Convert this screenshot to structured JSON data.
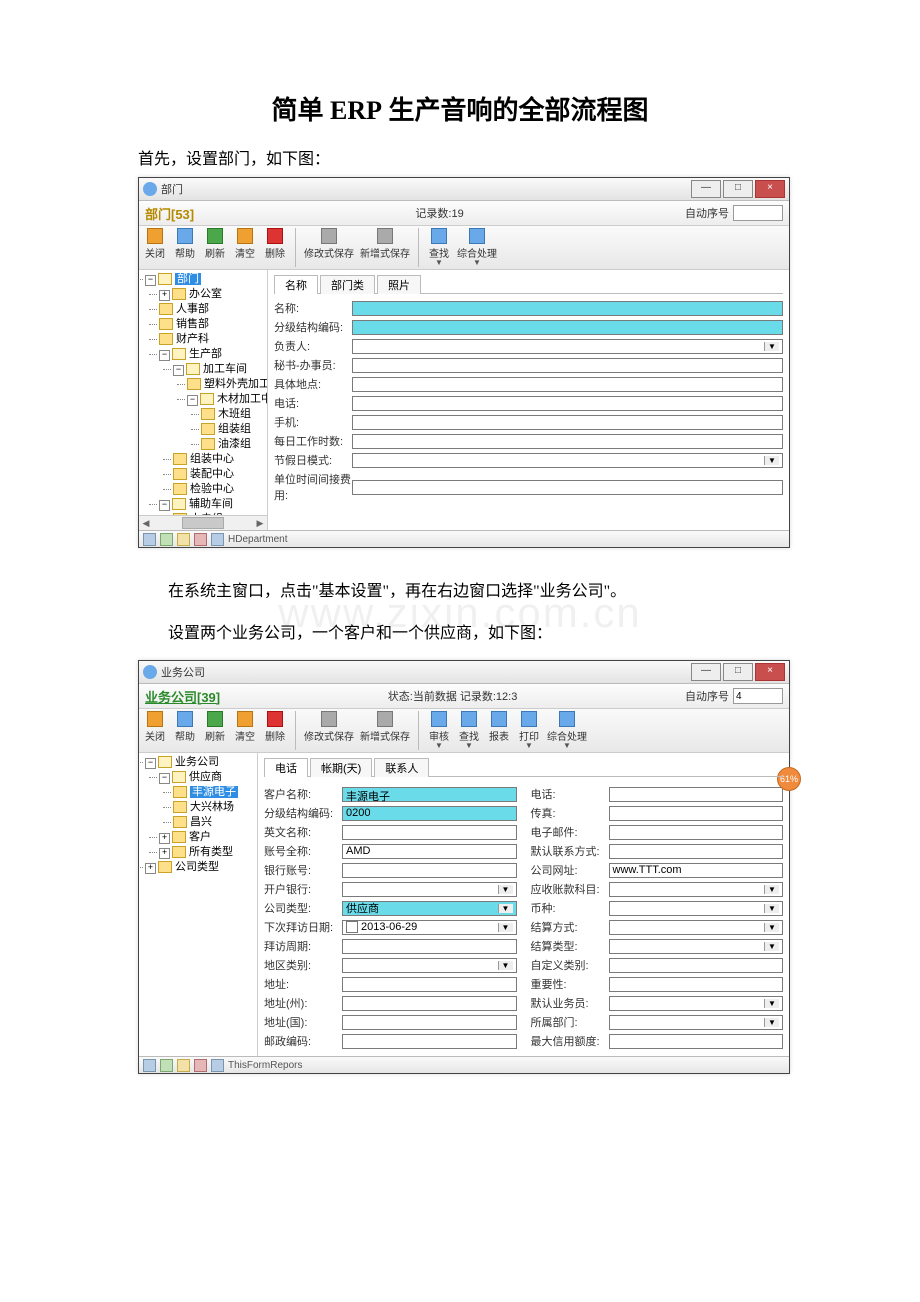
{
  "doc": {
    "title_pre": "简单 ",
    "title_erp": "ERP",
    "title_post": " 生产音响的全部流程图",
    "intro": "首先，设置部门，如下图：",
    "body1": "在系统主窗口，点击\"基本设置\"，再在右边窗口选择\"业务公司\"。",
    "body2": "设置两个业务公司，一个客户和一个供应商，如下图：",
    "watermark": "www.zixin.com.cn"
  },
  "win1": {
    "title": "部门",
    "header_title": "部门[53]",
    "record_count": "记录数:19",
    "right_label": "自动序号",
    "right_value": "",
    "toolbar": [
      "关闭",
      "帮助",
      "刷新",
      "清空",
      "删除",
      "修改式保存",
      "新增式保存",
      "查找",
      "综合处理"
    ],
    "tabs": [
      "名称",
      "部门类",
      "照片"
    ],
    "tree": {
      "root": "部门",
      "n1": "办公室",
      "n2": "人事部",
      "n3": "销售部",
      "n4": "财产科",
      "n5": "生产部",
      "n5a": "加工车间",
      "n5a1": "塑料外壳加工中",
      "n5a2": "木材加工中心",
      "n5a2a": "木班组",
      "n5a2b": "组装组",
      "n5a2c": "油漆组",
      "n5b": "组装中心",
      "n5c": "装配中心",
      "n5d": "检验中心",
      "n6": "辅助车间",
      "n6a": "水电组"
    },
    "fields": {
      "f1": "名称:",
      "f2": "分级结构编码:",
      "f3": "负责人:",
      "f4": "秘书-办事员:",
      "f5": "具体地点:",
      "f6": "电话:",
      "f7": "手机:",
      "f8": "每日工作时数:",
      "f9": "节假日模式:",
      "f10": "单位时间间接费用:"
    },
    "status": "HDepartment"
  },
  "win2": {
    "title": "业务公司",
    "header_title": "业务公司[39]",
    "center": "状态:当前数据 记录数:12:3",
    "right_label": "自动序号",
    "right_value": "4",
    "toolbar": [
      "关闭",
      "帮助",
      "刷新",
      "清空",
      "删除",
      "修改式保存",
      "新增式保存",
      "审核",
      "查找",
      "报表",
      "打印",
      "综合处理"
    ],
    "tabs": [
      "电话",
      "帐期(天)",
      "联系人"
    ],
    "tree": {
      "root": "业务公司",
      "s1": "供应商",
      "s1a": "丰源电子",
      "s1b": "大兴林场",
      "s1c": "昌兴",
      "s2": "客户",
      "s3": "所有类型",
      "s4": "公司类型"
    },
    "left_fields": {
      "f1": {
        "label": "客户名称:",
        "value": "丰源电子",
        "hl": true
      },
      "f2": {
        "label": "分级结构编码:",
        "value": "0200",
        "hl": true
      },
      "f3": {
        "label": "英文名称:",
        "value": ""
      },
      "f4": {
        "label": "账号全称:",
        "value": "AMD"
      },
      "f5": {
        "label": "银行账号:",
        "value": ""
      },
      "f6": {
        "label": "开户银行:",
        "value": "",
        "select": true
      },
      "f7": {
        "label": "公司类型:",
        "value": "供应商",
        "hl": true,
        "select": true
      },
      "f8": {
        "label": "下次拜访日期:",
        "value": "2013-06-29",
        "date": true
      },
      "f9": {
        "label": "拜访周期:",
        "value": ""
      },
      "f10": {
        "label": "地区类别:",
        "value": "",
        "select": true
      },
      "f11": {
        "label": "地址:",
        "value": ""
      },
      "f12": {
        "label": "地址(州):",
        "value": ""
      },
      "f13": {
        "label": "地址(国):",
        "value": ""
      },
      "f14": {
        "label": "邮政编码:",
        "value": ""
      }
    },
    "right_fields": {
      "r1": {
        "label": "电话:",
        "value": ""
      },
      "r2": {
        "label": "传真:",
        "value": ""
      },
      "r3": {
        "label": "电子邮件:",
        "value": ""
      },
      "r4": {
        "label": "默认联系方式:",
        "value": ""
      },
      "r5": {
        "label": "公司网址:",
        "value": "www.TTT.com"
      },
      "r6": {
        "label": "应收账款科目:",
        "value": "",
        "select": true
      },
      "r7": {
        "label": "币种:",
        "value": "",
        "select": true
      },
      "r8": {
        "label": "结算方式:",
        "value": "",
        "select": true
      },
      "r9": {
        "label": "结算类型:",
        "value": "",
        "select": true
      },
      "r10": {
        "label": "自定义类别:",
        "value": ""
      },
      "r11": {
        "label": "重要性:",
        "value": ""
      },
      "r12": {
        "label": "默认业务员:",
        "value": "",
        "select": true
      },
      "r13": {
        "label": "所属部门:",
        "value": "",
        "select": true
      },
      "r14": {
        "label": "最大信用额度:",
        "value": ""
      }
    },
    "side_badge": "61%",
    "status": "ThisFormRepors"
  },
  "winbtns": {
    "min": "—",
    "max": "□",
    "close": "×"
  }
}
